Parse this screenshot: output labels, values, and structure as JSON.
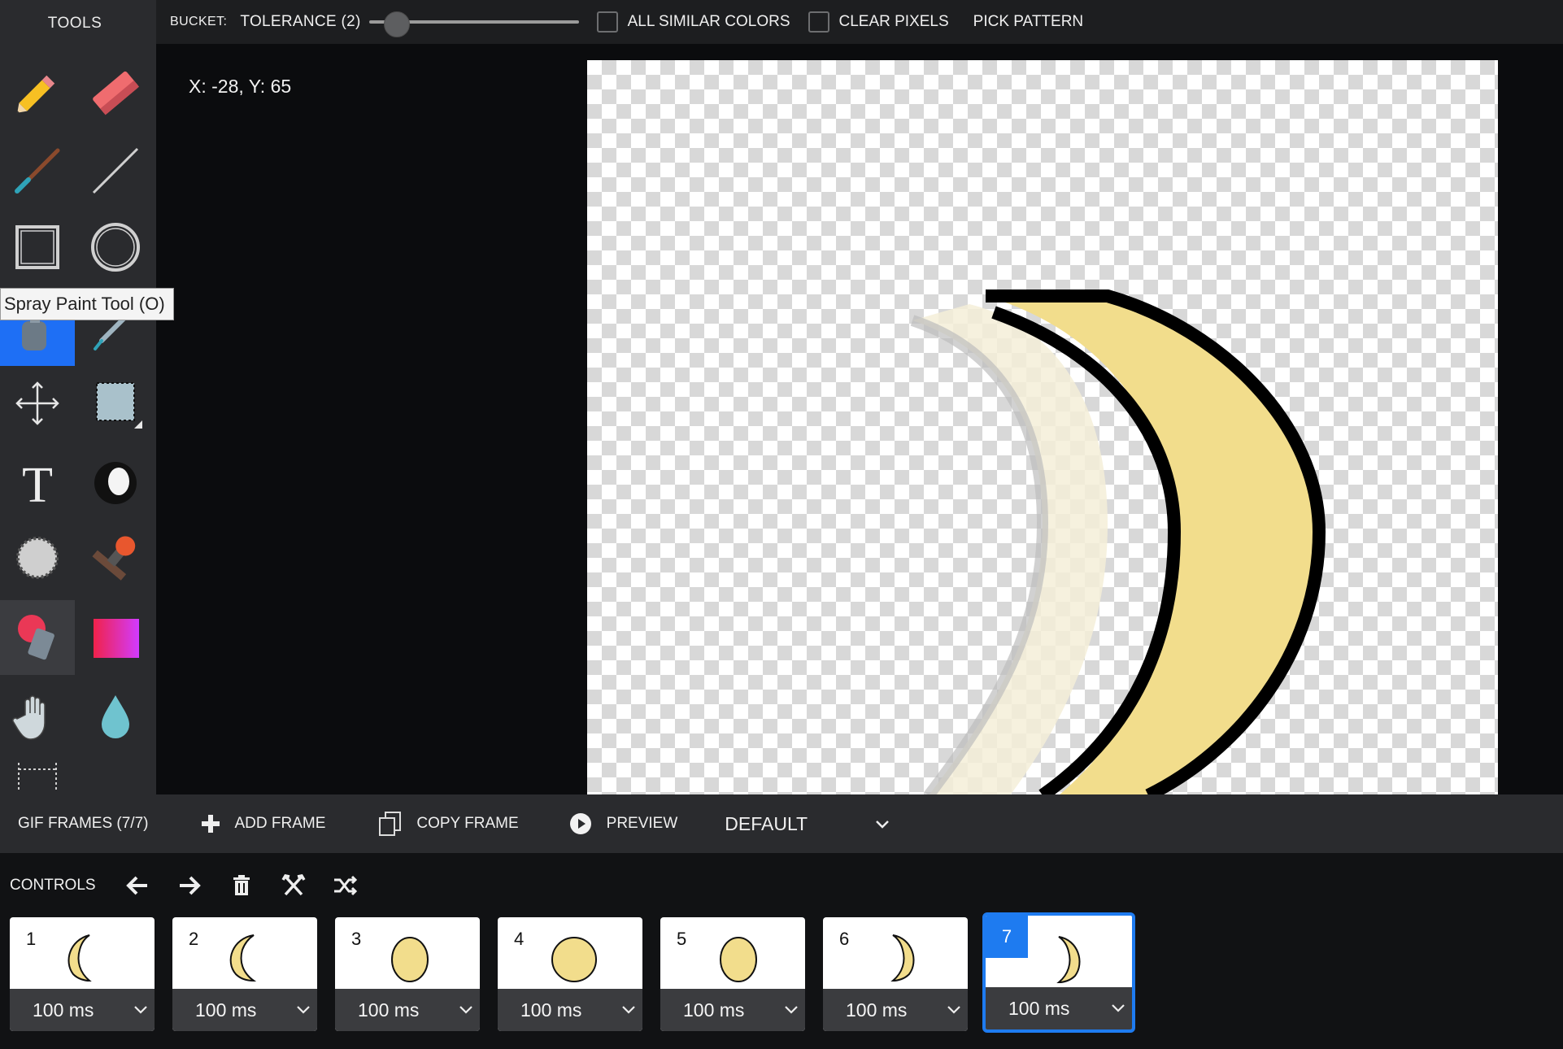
{
  "sidebar": {
    "title": "TOOLS",
    "tooltip": "Spray Paint Tool (O)",
    "tools": [
      {
        "name": "pencil-icon"
      },
      {
        "name": "eraser-icon"
      },
      {
        "name": "brush-icon"
      },
      {
        "name": "line-icon"
      },
      {
        "name": "rectangle-icon"
      },
      {
        "name": "ellipse-icon"
      },
      {
        "name": "spray-paint-icon",
        "active": true
      },
      {
        "name": "eyedropper-icon"
      },
      {
        "name": "move-icon"
      },
      {
        "name": "selection-icon"
      },
      {
        "name": "text-icon"
      },
      {
        "name": "lighten-darken-icon"
      },
      {
        "name": "dither-icon"
      },
      {
        "name": "stamp-icon"
      },
      {
        "name": "bucket-icon",
        "hover": true
      },
      {
        "name": "gradient-icon"
      },
      {
        "name": "hand-icon"
      },
      {
        "name": "blur-icon"
      },
      {
        "name": "crop-icon"
      }
    ]
  },
  "options": {
    "tool_label": "BUCKET:",
    "tolerance_label": "TOLERANCE (2)",
    "tolerance_value": 2,
    "all_similar_label": "ALL SIMILAR COLORS",
    "all_similar_checked": false,
    "clear_pixels_label": "CLEAR PIXELS",
    "clear_pixels_checked": false,
    "pick_pattern_label": "PICK PATTERN"
  },
  "canvas": {
    "coords": "X: -28, Y: 65",
    "fill_color": "#f2dd8c",
    "outline_color": "#000000"
  },
  "frames_bar": {
    "title": "GIF FRAMES (7/7)",
    "add_frame": "ADD FRAME",
    "copy_frame": "COPY FRAME",
    "preview": "PREVIEW",
    "mode_select": "DEFAULT"
  },
  "controls": {
    "label": "CONTROLS"
  },
  "frames": [
    {
      "num": "1",
      "duration": "100 ms",
      "phase": "waxing-crescent"
    },
    {
      "num": "2",
      "duration": "100 ms",
      "phase": "waxing-crescent"
    },
    {
      "num": "3",
      "duration": "100 ms",
      "phase": "gibbous"
    },
    {
      "num": "4",
      "duration": "100 ms",
      "phase": "full"
    },
    {
      "num": "5",
      "duration": "100 ms",
      "phase": "gibbous"
    },
    {
      "num": "6",
      "duration": "100 ms",
      "phase": "waning-crescent"
    },
    {
      "num": "7",
      "duration": "100 ms",
      "phase": "waning-crescent",
      "selected": true
    }
  ],
  "accent_color": "#1e6ff5"
}
